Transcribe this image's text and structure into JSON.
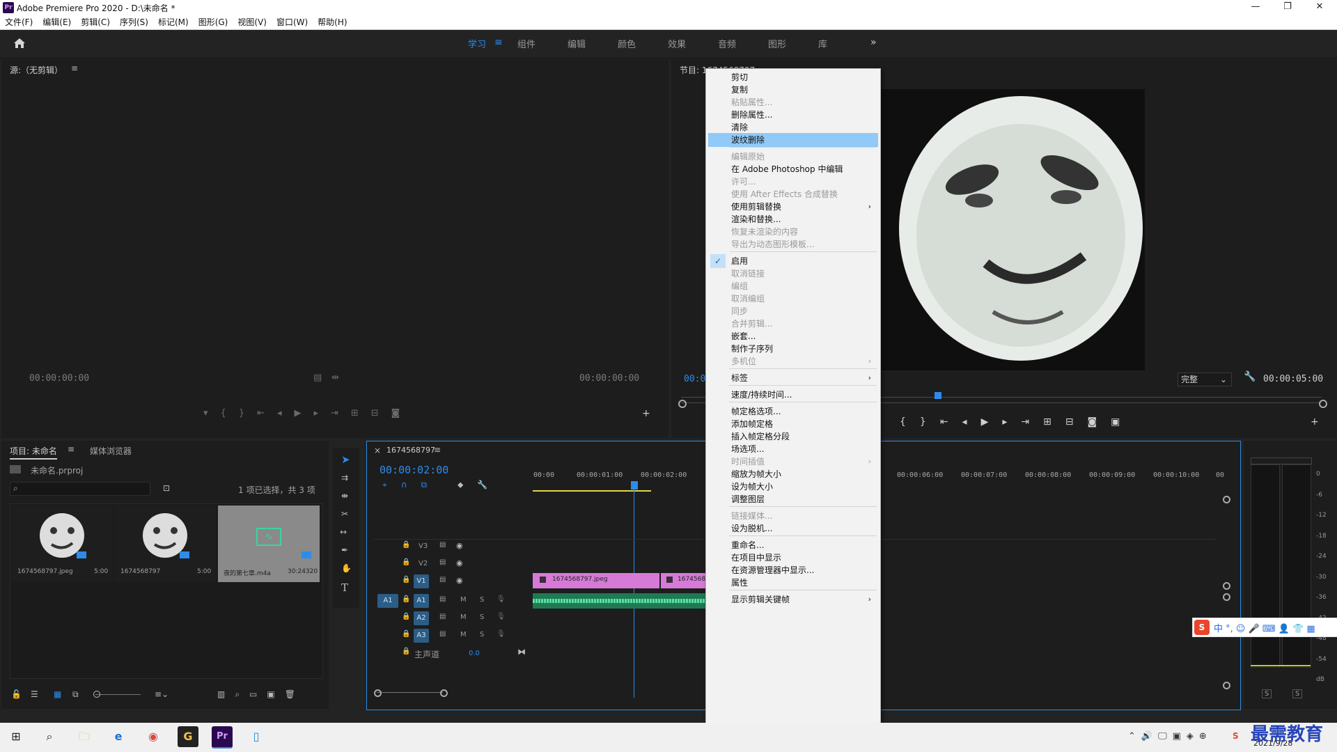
{
  "window": {
    "title": "Adobe Premiere Pro 2020 - D:\\未命名 *",
    "app_icon": "Pr",
    "minimize": "—",
    "maximize": "❐",
    "close": "✕"
  },
  "menubar": [
    "文件(F)",
    "编辑(E)",
    "剪辑(C)",
    "序列(S)",
    "标记(M)",
    "图形(G)",
    "视图(V)",
    "窗口(W)",
    "帮助(H)"
  ],
  "workspaces": {
    "items": [
      "学习",
      "组件",
      "编辑",
      "颜色",
      "效果",
      "音频",
      "图形",
      "库"
    ],
    "active": "学习",
    "more": "»"
  },
  "source_monitor": {
    "title": "源:（无剪辑）",
    "timecode_left": "00:00:00:00",
    "timecode_right": "00:00:00:00"
  },
  "program_monitor": {
    "title": "节目: 1674568797",
    "timecode_left": "00:0",
    "quality": "完整",
    "duration": "00:00:05:00"
  },
  "project": {
    "tab_active": "项目: 未命名",
    "tab_other": "媒体浏览器",
    "file": "未命名.prproj",
    "selection_info": "1 项已选择，共 3 项",
    "items": [
      {
        "name": "1674568797.jpeg",
        "duration": "5:00"
      },
      {
        "name": "1674568797",
        "duration": "5:00"
      },
      {
        "name": "夜的第七章.m4a",
        "duration": "30:24320"
      }
    ]
  },
  "timeline": {
    "sequence_name": "1674568797",
    "timecode": "00:00:02:00",
    "ruler_labels": [
      "00:00",
      "00:00:01:00",
      "00:00:02:00",
      "00:00:06:00",
      "00:00:07:00",
      "00:00:08:00",
      "00:00:09:00",
      "00:00:10:00",
      "00"
    ],
    "video_tracks": [
      "V3",
      "V2",
      "V1"
    ],
    "audio_tracks": [
      "A1",
      "A2",
      "A3"
    ],
    "source_patch": "A1",
    "master_label": "主声道",
    "master_value": "0.0",
    "clip1_name": "1674568797.jpeg",
    "clip2_name": "1674568",
    "audio_ms": [
      "M",
      "S"
    ]
  },
  "audio_meter": {
    "scale": [
      "0",
      "-6",
      "-12",
      "-18",
      "-24",
      "-30",
      "-36",
      "-42",
      "-48",
      "-54",
      "dB"
    ],
    "solo_labels": [
      "S",
      "S"
    ]
  },
  "context_menu": {
    "items": [
      {
        "label": "剪切",
        "disabled": false
      },
      {
        "label": "复制",
        "disabled": false
      },
      {
        "label": "粘贴属性...",
        "disabled": true
      },
      {
        "label": "删除属性...",
        "disabled": false
      },
      {
        "label": "清除",
        "disabled": false
      },
      {
        "label": "波纹删除",
        "disabled": false,
        "highlighted": true
      },
      {
        "sep": true
      },
      {
        "label": "编辑原始",
        "disabled": true
      },
      {
        "label": "在 Adobe Photoshop 中编辑",
        "disabled": false
      },
      {
        "label": "许可...",
        "disabled": true
      },
      {
        "label": "使用 After Effects 合成替换",
        "disabled": true
      },
      {
        "label": "使用剪辑替换",
        "disabled": false,
        "submenu": true
      },
      {
        "label": "渲染和替换...",
        "disabled": false
      },
      {
        "label": "恢复未渲染的内容",
        "disabled": true
      },
      {
        "label": "导出为动态图形模板...",
        "disabled": true
      },
      {
        "sep": true
      },
      {
        "label": "启用",
        "disabled": false,
        "checked": true
      },
      {
        "label": "取消链接",
        "disabled": true
      },
      {
        "label": "编组",
        "disabled": true
      },
      {
        "label": "取消编组",
        "disabled": true
      },
      {
        "label": "同步",
        "disabled": true
      },
      {
        "label": "合并剪辑...",
        "disabled": true
      },
      {
        "label": "嵌套...",
        "disabled": false
      },
      {
        "label": "制作子序列",
        "disabled": false
      },
      {
        "label": "多机位",
        "disabled": true,
        "submenu": true
      },
      {
        "sep": true
      },
      {
        "label": "标签",
        "disabled": false,
        "submenu": true
      },
      {
        "sep": true
      },
      {
        "label": "速度/持续时间...",
        "disabled": false
      },
      {
        "sep": true
      },
      {
        "label": "帧定格选项...",
        "disabled": false
      },
      {
        "label": "添加帧定格",
        "disabled": false
      },
      {
        "label": "插入帧定格分段",
        "disabled": false
      },
      {
        "label": "场选项...",
        "disabled": false
      },
      {
        "label": "时间插值",
        "disabled": true,
        "submenu": true
      },
      {
        "label": "缩放为帧大小",
        "disabled": false
      },
      {
        "label": "设为帧大小",
        "disabled": false
      },
      {
        "label": "调整图层",
        "disabled": false
      },
      {
        "sep": true
      },
      {
        "label": "链接媒体...",
        "disabled": true
      },
      {
        "label": "设为脱机...",
        "disabled": false
      },
      {
        "sep": true
      },
      {
        "label": "重命名...",
        "disabled": false
      },
      {
        "label": "在项目中显示",
        "disabled": false
      },
      {
        "label": "在资源管理器中显示...",
        "disabled": false
      },
      {
        "label": "属性",
        "disabled": false
      },
      {
        "sep": true
      },
      {
        "label": "显示剪辑关键帧",
        "disabled": false,
        "submenu": true
      }
    ]
  },
  "ime": {
    "logo": "S",
    "text": "中 °, ☺ 🎤 ⌨ 👤 👕 ▦"
  },
  "taskbar": {
    "date": "2021/9/28",
    "watermark": "最需教育"
  }
}
